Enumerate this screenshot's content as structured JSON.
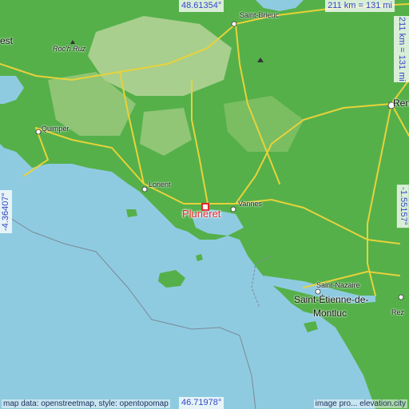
{
  "map": {
    "place": "Pluneret",
    "coordinates": {
      "top_latitude": "48.61354°",
      "bottom_latitude": "46.71978°",
      "left_longitude": "-4.36407°",
      "right_longitude": "-1.55157°"
    },
    "scale": {
      "top": "211 km = 131 mi",
      "right": "211 km = 131 mi"
    },
    "credits": {
      "left": "map data: openstreetmap, style: opentopomap",
      "right": "image pro... elevation.city"
    },
    "cities": [
      "Saint-Brieuc",
      "Roc'h Ruz",
      "Quimper",
      "Lorient",
      "Vannes",
      "Saint-Nazaire",
      "Saint-Étienne-de-",
      "Montluc",
      "Ren",
      "Rez",
      "est"
    ],
    "colors": {
      "sea": "#8fcbe0",
      "lowland": "#55b04a",
      "highland": "#b8d59a",
      "highlight": "#e2272b",
      "road": "#e8d23a"
    }
  }
}
